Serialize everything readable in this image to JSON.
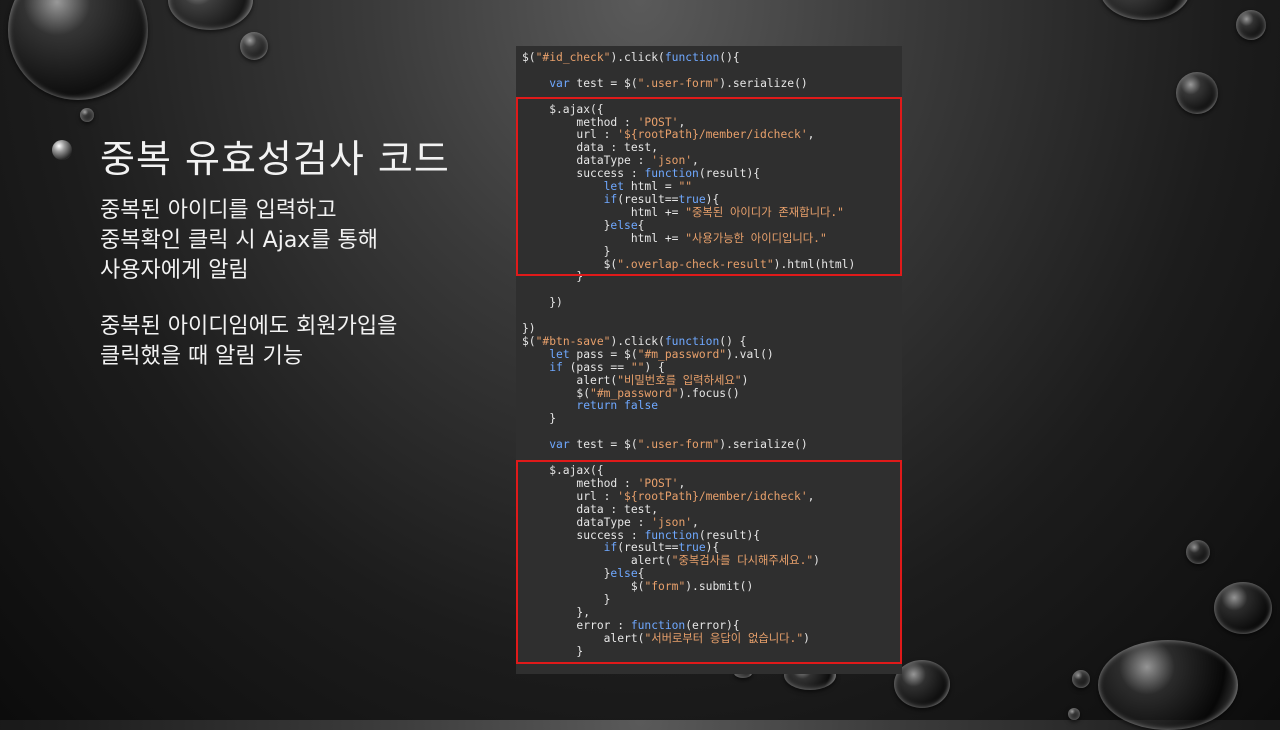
{
  "slide": {
    "title": "중복 유효성검사 코드",
    "paragraph1": [
      "중복된 아이디를 입력하고",
      "중복확인 클릭 시 Ajax를 통해",
      "사용자에게 알림"
    ],
    "paragraph2": [
      "중복된 아이디임에도 회원가입을",
      "클릭했을 때 알림 기능"
    ]
  },
  "code": {
    "block1": {
      "l1": "$(\"#id_check\").click(function(){",
      "l2": "    var test = $(\".user-form\").serialize()",
      "l3": "    $.ajax({",
      "l4": "        method : 'POST',",
      "l5": "        url : '${rootPath}/member/idcheck',",
      "l6": "        data : test,",
      "l7": "        dataType : 'json',",
      "l8": "        success : function(result){",
      "l9": "            let html = \"\"",
      "l10": "            if(result==true){",
      "l11": "                html += \"중복된 아이디가 존재합니다.\"",
      "l12": "            }else{",
      "l13": "                html += \"사용가능한 아이디입니다.\"",
      "l14": "            }",
      "l15": "            $(\".overlap-check-result\").html(html)",
      "l16": "        }",
      "l17": "    })",
      "l18": "})"
    },
    "block2": {
      "l1": "$(\"#btn-save\").click(function() {",
      "l2": "    let pass = $(\"#m_password\").val()",
      "l3": "    if (pass == \"\") {",
      "l4": "        alert(\"비밀번호를 입력하세요\")",
      "l5": "        $(\"#m_password\").focus()",
      "l6": "        return false",
      "l7": "    }",
      "l8": "    var test = $(\".user-form\").serialize()",
      "l9": "    $.ajax({",
      "l10": "        method : 'POST',",
      "l11": "        url : '${rootPath}/member/idcheck',",
      "l12": "        data : test,",
      "l13": "        dataType : 'json',",
      "l14": "        success : function(result){",
      "l15": "            if(result==true){",
      "l16": "                alert(\"중복검사를 다시해주세요.\")",
      "l17": "            }else{",
      "l18": "                $(\"form\").submit()",
      "l19": "            }",
      "l20": "        },",
      "l21": "        error : function(error){",
      "l22": "            alert(\"서버로부터 응답이 없습니다.\")",
      "l23": "        }"
    }
  },
  "colors": {
    "keyword": "#6fa8ff",
    "string": "#e8a06b",
    "highlight": "#e01a1a",
    "panel": "#2f2f2f"
  }
}
